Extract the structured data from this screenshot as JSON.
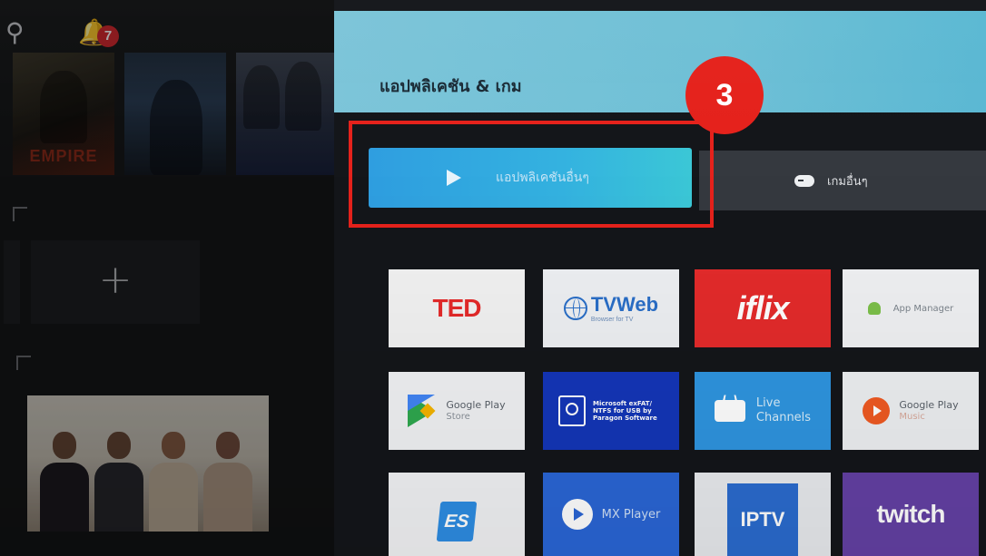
{
  "sidebar": {
    "notification_count": "7",
    "icons": {
      "search": "search-icon",
      "notifications": "bell-icon",
      "add": "plus-icon"
    },
    "posters": [
      {
        "title": "EMPIRE"
      },
      {
        "title": ""
      },
      {
        "title": ""
      }
    ]
  },
  "header": {
    "title": "แอปพลิเคชัน & เกม",
    "step_badge": "3"
  },
  "buttons": {
    "other_apps": "แอปพลิเคชันอื่นๆ",
    "other_games": "เกมอื่นๆ"
  },
  "apps": [
    {
      "name": "TED",
      "bg": "#f2f2f2"
    },
    {
      "name": "TVWeb",
      "subtitle": "Browser for TV",
      "bg": "#eef0f3"
    },
    {
      "name": "iflix",
      "bg": "#e42b2b"
    },
    {
      "name": "App Manager",
      "bg": "#f0f1f3"
    },
    {
      "name": "Google Play",
      "subtitle": "Store",
      "bg": "#f1f2f4"
    },
    {
      "name": "Microsoft exFAT/ NTFS for USB by Paragon Software",
      "bg": "#1436b8"
    },
    {
      "name": "Live",
      "subtitle": "Channels",
      "bg": "#2f95e0"
    },
    {
      "name": "Google Play",
      "subtitle": "Music",
      "bg": "#eef0f2"
    },
    {
      "name": "ES",
      "bg": "#f2f3f5"
    },
    {
      "name": "MX Player",
      "bg": "#2a66d6"
    },
    {
      "name": "IPTV",
      "bg": "#e9ebee"
    },
    {
      "name": "twitch",
      "bg": "#6441a4"
    }
  ],
  "colors": {
    "accent_red": "#e5221c",
    "header_blue": "#6ec0d6",
    "focus_blue": "#2f9ee0"
  }
}
